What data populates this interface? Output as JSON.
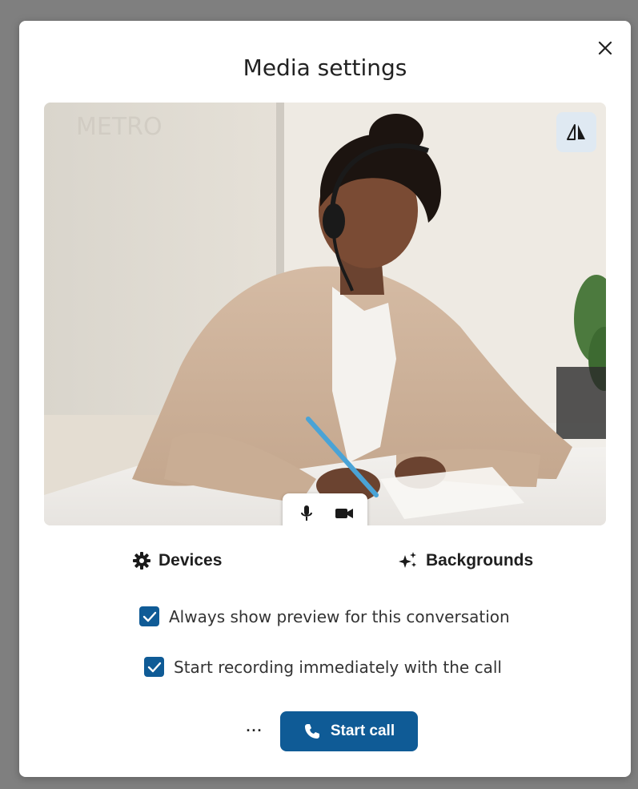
{
  "dialog": {
    "title": "Media settings",
    "close_icon": "close-icon"
  },
  "preview": {
    "mirror_icon": "mirror-icon",
    "controls": {
      "mic_icon": "microphone-icon",
      "camera_icon": "video-camera-icon"
    }
  },
  "options": {
    "devices_label": "Devices",
    "devices_icon": "gear-icon",
    "backgrounds_label": "Backgrounds",
    "backgrounds_icon": "sparkle-icon"
  },
  "checkboxes": [
    {
      "label": "Always show preview for this conversation",
      "checked": true
    },
    {
      "label": "Start recording immediately with the call",
      "checked": true
    }
  ],
  "footer": {
    "more_label": "···",
    "start_call_label": "Start call",
    "start_call_icon": "phone-icon"
  },
  "colors": {
    "accent": "#0f5b96",
    "mirror_bg": "#dfe9f2",
    "backdrop": "#7f7f7f"
  }
}
